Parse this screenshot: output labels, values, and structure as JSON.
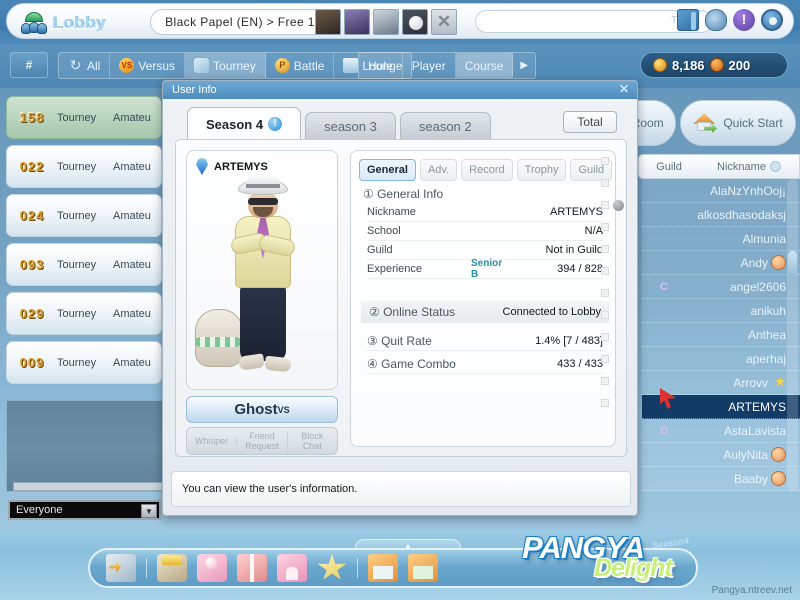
{
  "topbar": {
    "lobby_label": "Lobby",
    "server": "Black Papel (EN) > Free 1",
    "ticker_placeholder": "Ticker",
    "icons": [
      "book-icon",
      "snail-icon",
      "notice-icon",
      "gear-icon"
    ],
    "close_label": "✕"
  },
  "navbar": {
    "hash_label": "#",
    "filters": [
      {
        "label": "All",
        "icon": "refresh-icon",
        "active": false
      },
      {
        "label": "Versus",
        "icon": "vs-icon",
        "active": false
      },
      {
        "label": "Tourney",
        "icon": "tourney-icon",
        "active": true
      },
      {
        "label": "Battle",
        "icon": "battle-icon",
        "active": false
      },
      {
        "label": "Lounge",
        "icon": "lounge-icon",
        "active": false
      }
    ],
    "sorts": [
      {
        "label": "Hole",
        "selected": false
      },
      {
        "label": "Player",
        "selected": false
      },
      {
        "label": "Course",
        "selected": true
      }
    ],
    "next_arrow": "▶",
    "currency": {
      "pang_value": "8,186",
      "cookie_value": "200"
    }
  },
  "rooms": [
    {
      "num": "158",
      "mode": "Tourney",
      "level": "Amateu",
      "active": true
    },
    {
      "num": "022",
      "mode": "Tourney",
      "level": "Amateu",
      "active": false
    },
    {
      "num": "024",
      "mode": "Tourney",
      "level": "Amateu",
      "active": false
    },
    {
      "num": "093",
      "mode": "Tourney",
      "level": "Amateu",
      "active": false
    },
    {
      "num": "029",
      "mode": "Tourney",
      "level": "Amateu",
      "active": false
    },
    {
      "num": "009",
      "mode": "Tourney",
      "level": "Amateu",
      "active": false
    }
  ],
  "chat": {
    "scope_value": "Everyone",
    "scope_arrow": "▼"
  },
  "right": {
    "create_room_label": "Create Room",
    "quick_start_label": "Quick Start",
    "list_header": {
      "guild": "Guild",
      "nickname": "Nickname"
    },
    "players": [
      {
        "guild": "",
        "nick": "AlaNzYnhOoj¡",
        "emoji": "",
        "selected": false
      },
      {
        "guild": "",
        "nick": "alkosdhasodaksj",
        "emoji": "",
        "selected": false
      },
      {
        "guild": "",
        "nick": "Almunia",
        "emoji": "",
        "selected": false
      },
      {
        "guild": "",
        "nick": "Andy",
        "emoji": "face-icon",
        "selected": false
      },
      {
        "guild": "C",
        "nick": "angel2606",
        "emoji": "",
        "selected": false
      },
      {
        "guild": "",
        "nick": "anikuh",
        "emoji": "",
        "selected": false
      },
      {
        "guild": "",
        "nick": "Anthea",
        "emoji": "",
        "selected": false
      },
      {
        "guild": "",
        "nick": "aperhaj",
        "emoji": "",
        "selected": false
      },
      {
        "guild": "",
        "nick": "Arrovv",
        "emoji": "star-icon",
        "selected": false
      },
      {
        "guild": "",
        "nick": "ARTEMYS",
        "emoji": "",
        "selected": true
      },
      {
        "guild": "D",
        "nick": "AstaLavista",
        "emoji": "",
        "selected": false
      },
      {
        "guild": "",
        "nick": "AulyNita",
        "emoji": "face-icon",
        "selected": false
      },
      {
        "guild": "",
        "nick": "Baaby",
        "emoji": "face-icon",
        "selected": false
      }
    ]
  },
  "dialog": {
    "title": "User Info",
    "close_label": "✕",
    "season_tabs": [
      {
        "label": "Season 4",
        "badge": "!",
        "active": true
      },
      {
        "label": "season 3",
        "badge": "",
        "active": false
      },
      {
        "label": "season 2",
        "badge": "",
        "active": false
      }
    ],
    "total_label": "Total",
    "avatar": {
      "nickname": "ARTEMYS"
    },
    "ghost_button": {
      "label": "Ghost",
      "sup": "VS"
    },
    "actions": [
      {
        "label_line1": "Whisper",
        "label_line2": ""
      },
      {
        "label_line1": "Friend",
        "label_line2": "Request"
      },
      {
        "label_line1": "Block",
        "label_line2": "Chat"
      }
    ],
    "info_tabs": [
      {
        "label": "General",
        "active": true
      },
      {
        "label": "Adv.",
        "active": false
      },
      {
        "label": "Record",
        "active": false
      },
      {
        "label": "Trophy",
        "active": false
      },
      {
        "label": "Guild",
        "active": false
      }
    ],
    "section1_title": "① General Info",
    "general_rows": [
      {
        "key": "Nickname",
        "mid": "",
        "value": "ARTEMYS"
      },
      {
        "key": "School",
        "mid": "",
        "value": "N/A"
      },
      {
        "key": "Guild",
        "mid": "",
        "value": "Not in Guild"
      },
      {
        "key": "Experience",
        "mid": "Senior B",
        "value": "394 / 828"
      }
    ],
    "section2": {
      "label": "② Online Status",
      "value": "Connected to Lobby"
    },
    "section3": {
      "label": "③ Quit Rate",
      "value": "1.4% [7 / 483]"
    },
    "section4": {
      "label": "④ Game Combo",
      "value": "433 / 433"
    },
    "status_text": "You can view the user's information."
  },
  "bottom": {
    "dock_icons": [
      "exit-icon",
      "shop-icon",
      "card-icon",
      "gift-icon",
      "home-icon",
      "star-icon",
      "house-buy-icon",
      "house-swap-icon"
    ],
    "collapse_arrow": "▲",
    "logo_main": "PANGYA",
    "logo_sub": "Delight",
    "logo_small": "Season4",
    "site": "Pangya.ntreev.net"
  }
}
